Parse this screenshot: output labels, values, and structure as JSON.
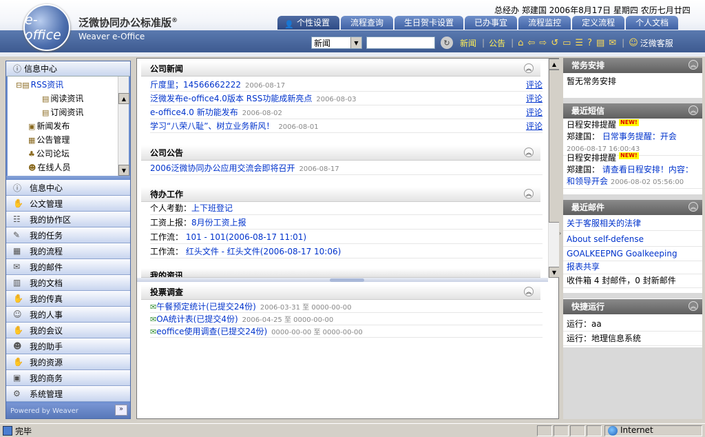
{
  "header": {
    "logo_text": "e-office",
    "product_title": "泛微协同办公标准版",
    "registered_mark": "®",
    "product_subtitle": "Weaver e-Office",
    "user_info": "总经办  郑建国  2006年8月17日  星期四  农历七月廿四"
  },
  "tabs": [
    {
      "label": "个性设置",
      "active": true
    },
    {
      "label": "流程查询"
    },
    {
      "label": "生日贺卡设置"
    },
    {
      "label": "已办事宜"
    },
    {
      "label": "流程监控"
    },
    {
      "label": "定义流程"
    },
    {
      "label": "个人文档"
    }
  ],
  "toolbar": {
    "select_value": "新闻",
    "search_value": "",
    "link_news": "新闻",
    "link_notice": "公告",
    "service_label": "泛微客服",
    "icons": [
      "home-icon",
      "back-arrow-icon",
      "forward-arrow-icon",
      "refresh-icon",
      "folder-icon",
      "list-icon",
      "help-icon",
      "books-icon",
      "email-icon"
    ]
  },
  "left": {
    "info_center_header": "信息中心",
    "tree": [
      "RSS资讯",
      "阅读资讯",
      "订阅资讯",
      "新闻发布",
      "公告管理",
      "公司论坛",
      "在线人员"
    ],
    "menu": [
      "信息中心",
      "公文管理",
      "我的协作区",
      "我的任务",
      "我的流程",
      "我的邮件",
      "我的文档",
      "我的传真",
      "我的人事",
      "我的会议",
      "我的助手",
      "我的资源",
      "我的商务",
      "系统管理"
    ],
    "footer": "Powered by Weaver",
    "footer_button": "»"
  },
  "center": {
    "news": {
      "title": "公司新闻",
      "items": [
        {
          "text": "斤度里；14566662222",
          "date": "2006-08-17",
          "comment": "评论"
        },
        {
          "text": "泛微发布e-office4.0版本 RSS功能成新亮点",
          "date": "2006-08-03",
          "comment": "评论"
        },
        {
          "text": "e-office4.0 新功能发布",
          "date": "2006-08-02",
          "comment": "评论"
        },
        {
          "text": "学习“八荣八耻”、树立业务新风！",
          "date": "2006-08-01",
          "comment": "评论"
        }
      ]
    },
    "notice": {
      "title": "公司公告",
      "items": [
        {
          "text": "2006泛微协同办公应用交流会即将召开",
          "date": "2006-08-17"
        }
      ]
    },
    "todo": {
      "title": "待办工作",
      "items": [
        {
          "label": "个人考勤：",
          "link": "上下班登记"
        },
        {
          "label": "工资上报：",
          "link": "8月份工资上报"
        },
        {
          "label": "工作流：",
          "link": " 101 - 101(2006-08-17 11:01)"
        },
        {
          "label": "工作流：",
          "link": " 红头文件 - 红头文件(2006-08-17 10:06)"
        }
      ]
    },
    "rss_title": "我的资讯",
    "vote": {
      "title": "投票调查",
      "items": [
        {
          "text": "午餐预定统计(已提交24份)",
          "dates": "2006-03-31 至 0000-00-00"
        },
        {
          "text": "OA统计表(已提交4份)",
          "dates": "2006-04-25 至 0000-00-00"
        },
        {
          "text": "eoffice使用调查(已提交24份)",
          "dates": "0000-00-00 至 0000-00-00"
        }
      ]
    }
  },
  "right": {
    "schedule": {
      "title": "常务安排",
      "empty": "暂无常务安排"
    },
    "sms": {
      "title": "最近短信",
      "items": [
        {
          "type": "日程安排提醒",
          "badge": "NEW!",
          "from": "郑建国：",
          "text": " 日常事务提醒：开会",
          "time": "2006-08-17 16:00:43"
        },
        {
          "type": "日程安排提醒",
          "badge": "NEW!",
          "from": "郑建国：",
          "text": " 请查看日程安排！内容：",
          "text2": "和领导开会",
          "time": "2006-08-02 05:56:00"
        }
      ]
    },
    "mail": {
      "title": "最近邮件",
      "items": [
        "关于客服相关的法律",
        "About self-defense",
        "GOALKEEPNG Goalkeeping",
        "报表共享"
      ],
      "inbox": "收件箱   4 封邮件，0 封新邮件"
    },
    "quick": {
      "title": "快捷运行",
      "items": [
        "运行：aa",
        "运行：地理信息系统"
      ]
    }
  },
  "status": {
    "text": "完毕",
    "zone": "Internet"
  }
}
